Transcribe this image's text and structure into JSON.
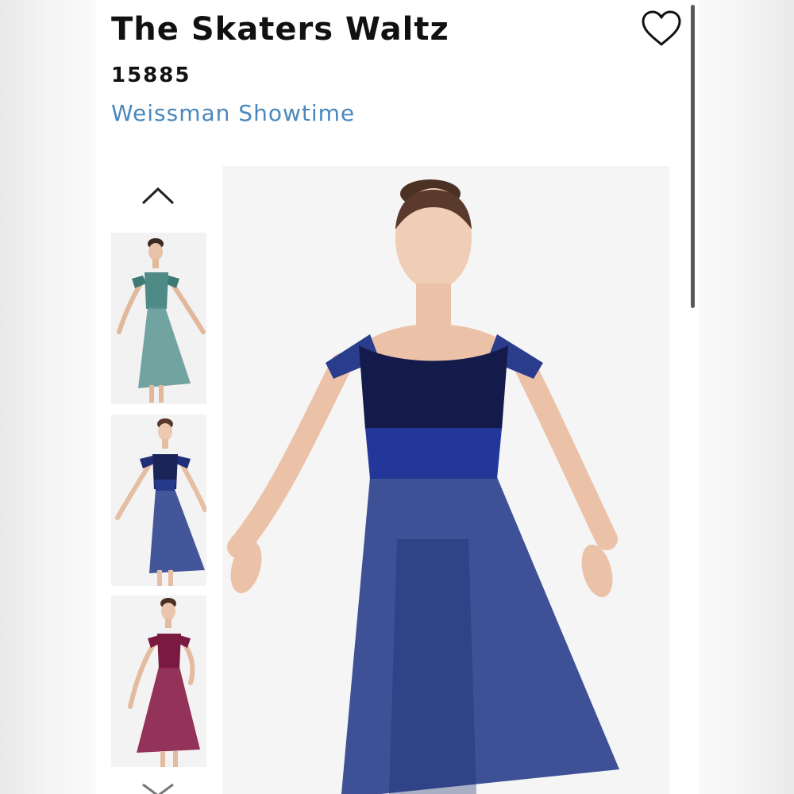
{
  "product": {
    "title": "The Skaters Waltz",
    "sku": "15885",
    "brand": "Weissman Showtime"
  },
  "icons": {
    "favorite": "heart-outline-icon",
    "thumbs_prev": "chevron-up-icon",
    "thumbs_next": "chevron-down-icon"
  },
  "gallery": {
    "thumbnails": [
      {
        "color": "teal",
        "dress_hex": "#4e8a86"
      },
      {
        "color": "navy",
        "dress_hex": "#243a8a"
      },
      {
        "color": "burgundy",
        "dress_hex": "#8a1e48"
      }
    ],
    "main_image": {
      "color": "navy",
      "dress_hex": "#243a8a"
    }
  },
  "colors": {
    "title": "#111111",
    "brand_link": "#4a88bd",
    "background": "#ffffff"
  }
}
